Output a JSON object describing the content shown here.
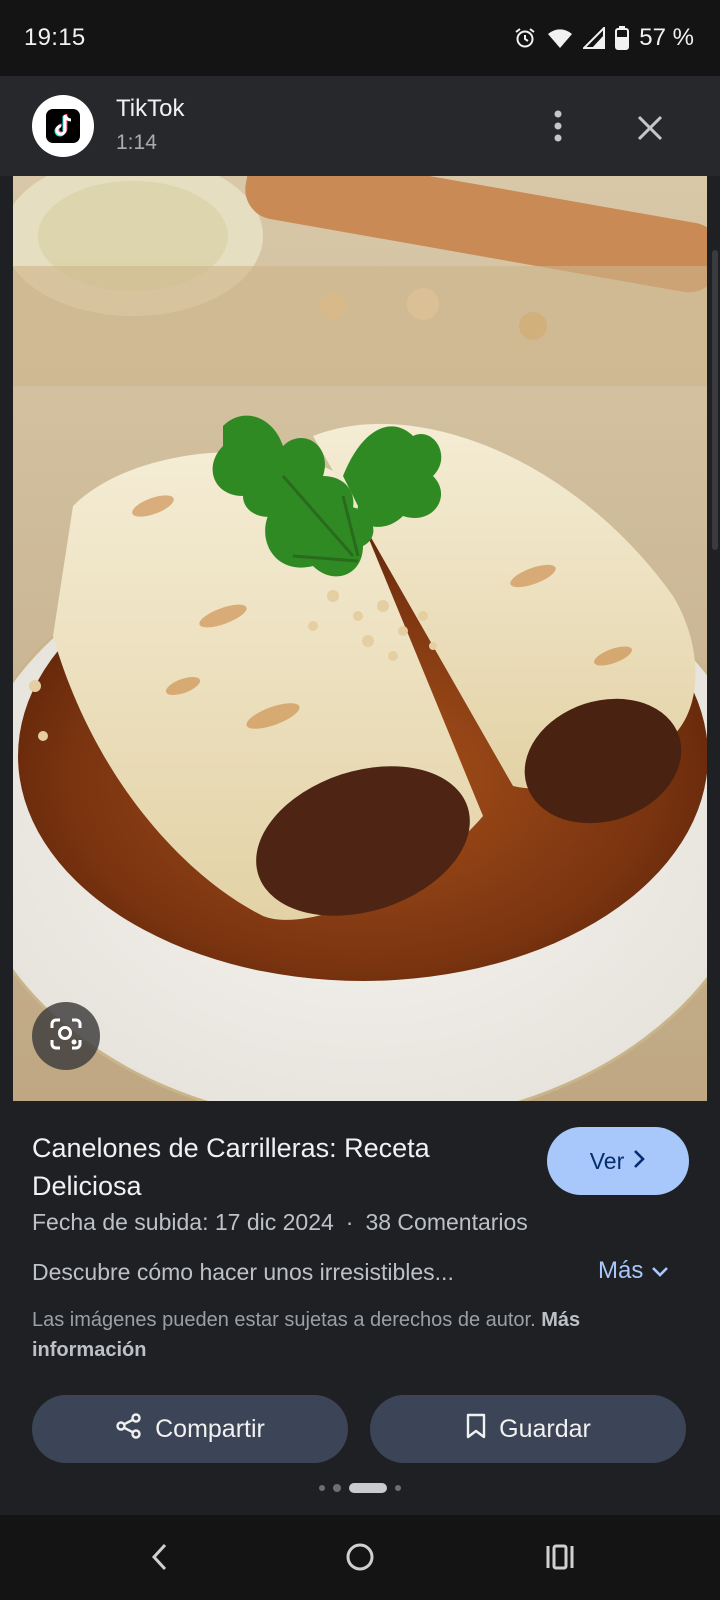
{
  "status_bar": {
    "time": "19:15",
    "battery": "57 %",
    "icons": [
      "alarm-icon",
      "wifi-icon",
      "signal-icon",
      "battery-icon"
    ]
  },
  "header": {
    "app_name": "TikTok",
    "duration": "1:14",
    "logo_icon": "tiktok-logo-icon",
    "more_icon": "more-vert-icon",
    "close_icon": "close-icon"
  },
  "image": {
    "lens_icon": "lens-search-icon"
  },
  "result": {
    "title": "Canelones de Carrilleras: Receta Deliciosa",
    "view_button": "Ver",
    "upload_date": "Fecha de subida: 17 dic 2024",
    "separator": "·",
    "comments": "38 Comentarios",
    "description": "Descubre cómo hacer unos irresistibles...",
    "more_label": "Más",
    "copyright_text": "Las imágenes pueden estar sujetas a derechos de autor.",
    "copyright_link": "Más información"
  },
  "actions": {
    "share_label": "Compartir",
    "save_label": "Guardar"
  },
  "colors": {
    "accent": "#a8c7fa",
    "button_bg": "#3c4557",
    "background": "#1f2024"
  }
}
